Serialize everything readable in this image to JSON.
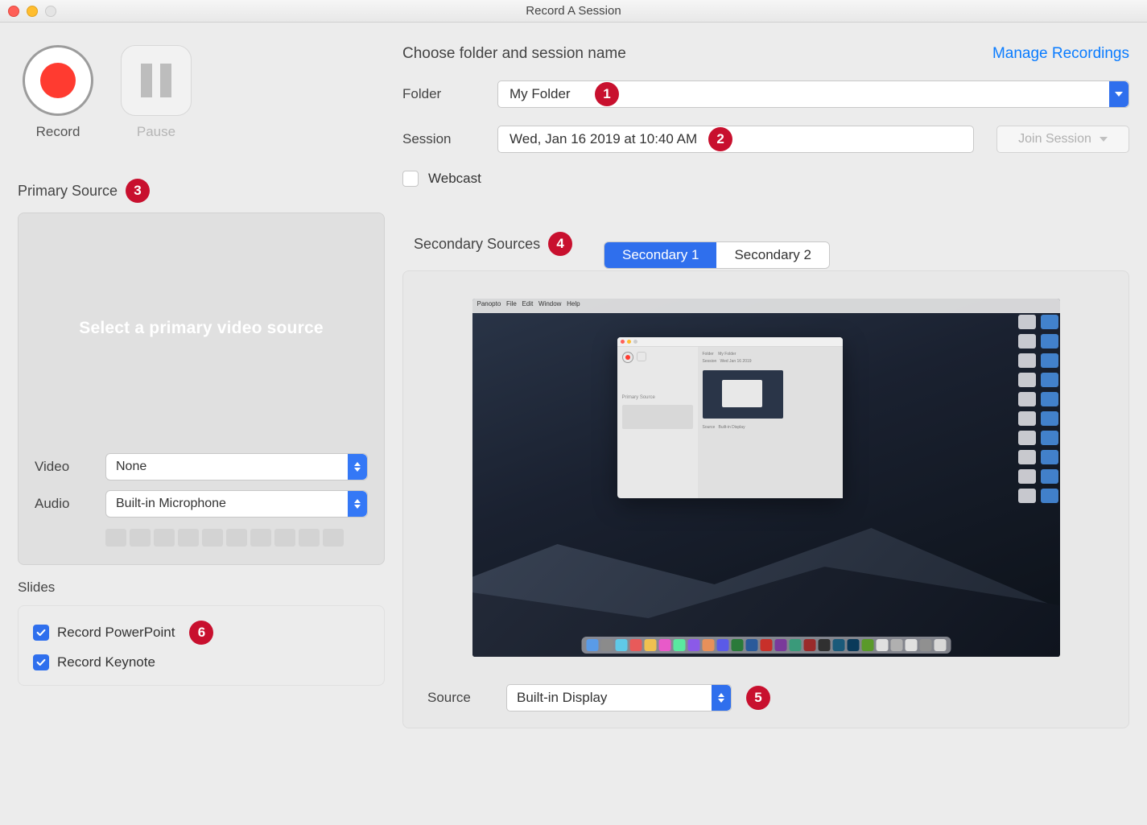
{
  "window": {
    "title": "Record A Session"
  },
  "header": {
    "choose_text": "Choose folder and session name",
    "manage_link": "Manage Recordings"
  },
  "controls": {
    "record_label": "Record",
    "pause_label": "Pause"
  },
  "form": {
    "folder_label": "Folder",
    "folder_value": "My Folder",
    "session_label": "Session",
    "session_value": "Wed, Jan 16 2019 at 10:40 AM",
    "join_session_label": "Join Session",
    "webcast_label": "Webcast"
  },
  "primary": {
    "heading": "Primary Source",
    "placeholder": "Select a primary video source",
    "video_label": "Video",
    "video_value": "None",
    "audio_label": "Audio",
    "audio_value": "Built-in Microphone"
  },
  "slides": {
    "heading": "Slides",
    "ppt_label": "Record PowerPoint",
    "keynote_label": "Record Keynote"
  },
  "secondary": {
    "heading": "Secondary Sources",
    "tab1": "Secondary 1",
    "tab2": "Secondary 2",
    "source_label": "Source",
    "source_value": "Built-in Display"
  },
  "badges": {
    "b1": "1",
    "b2": "2",
    "b3": "3",
    "b4": "4",
    "b5": "5",
    "b6": "6"
  }
}
